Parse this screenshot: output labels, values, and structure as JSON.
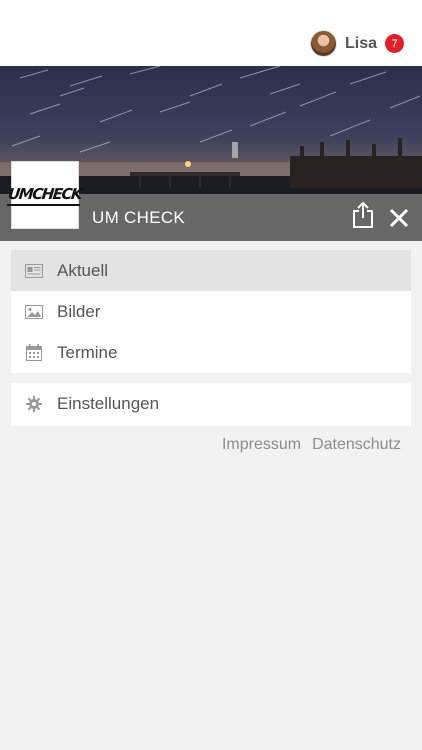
{
  "profile": {
    "name": "Lisa",
    "notification_count": "7"
  },
  "header": {
    "title": "UM CHECK",
    "logo_text": "UMCHECK"
  },
  "menu": [
    {
      "label": "Aktuell",
      "icon": "newspaper-icon",
      "active": true
    },
    {
      "label": "Bilder",
      "icon": "image-icon",
      "active": false
    },
    {
      "label": "Termine",
      "icon": "calendar-icon",
      "active": false
    }
  ],
  "settings": {
    "label": "Einstellungen",
    "icon": "gear-icon"
  },
  "footer": {
    "impressum": "Impressum",
    "datenschutz": "Datenschutz"
  },
  "colors": {
    "badge": "#e0202a",
    "active_row": "#e3e3e3",
    "caption_bar": "#6e6e6e"
  }
}
